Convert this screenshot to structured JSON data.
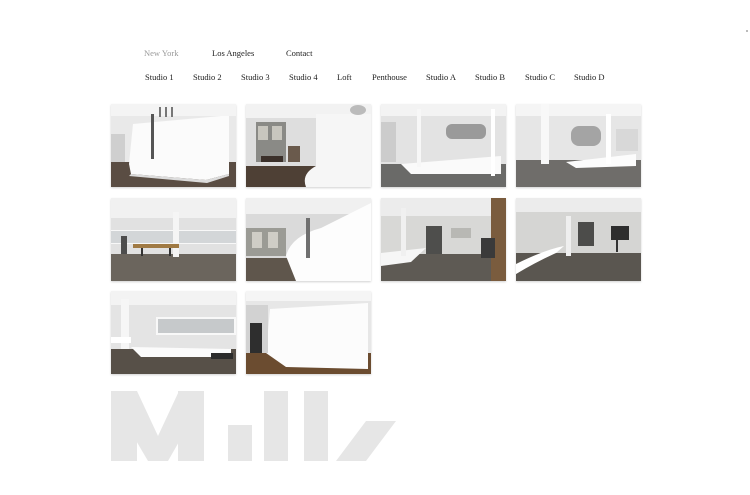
{
  "top_nav": {
    "items": [
      {
        "label": "New York",
        "active": true
      },
      {
        "label": "Los Angeles",
        "active": false
      },
      {
        "label": "Contact",
        "active": false
      }
    ]
  },
  "sub_nav": {
    "items": [
      "Studio 1",
      "Studio 2",
      "Studio 3",
      "Studio 4",
      "Loft",
      "Penthouse",
      "Studio A",
      "Studio B",
      "Studio C",
      "Studio D"
    ]
  },
  "gallery": {
    "photos": [
      {
        "name": "studio-photo-1"
      },
      {
        "name": "studio-photo-2"
      },
      {
        "name": "studio-photo-3"
      },
      {
        "name": "studio-photo-4"
      },
      {
        "name": "studio-photo-5"
      },
      {
        "name": "studio-photo-6"
      },
      {
        "name": "studio-photo-7"
      },
      {
        "name": "studio-photo-8"
      },
      {
        "name": "studio-photo-9"
      },
      {
        "name": "studio-photo-10"
      }
    ]
  },
  "logo": {
    "text": "Milk",
    "icon": "milk-logo-icon",
    "color": "#e6e6e6"
  },
  "colors": {
    "active_nav": "#999999",
    "nav": "#222222",
    "background": "#ffffff"
  }
}
